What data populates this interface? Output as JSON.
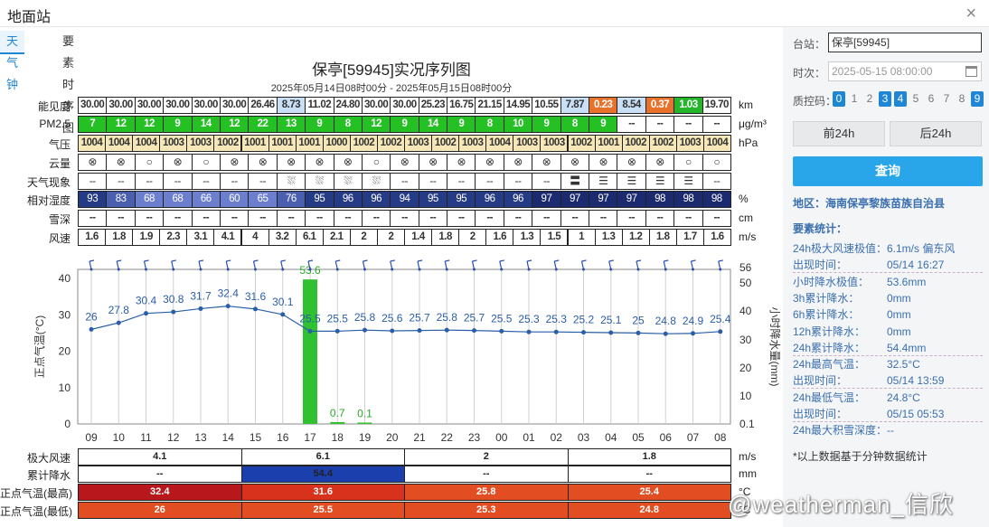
{
  "window": {
    "title": "地面站",
    "close_glyph": "×"
  },
  "tabs": [
    {
      "label": "天气钟",
      "active": true
    },
    {
      "label": "要素时序图",
      "active": false
    }
  ],
  "chart": {
    "title": "保亭[59945]实况序列图",
    "subtitle": "2025年05月14日08时00分 - 2025年05月15日08时00分"
  },
  "table": {
    "rows": [
      {
        "label": "能见度",
        "unit": "km",
        "key": "vis"
      },
      {
        "label": "PM2.5",
        "unit": "μg/m³",
        "key": "pm"
      },
      {
        "label": "气压",
        "unit": "hPa",
        "key": "pres"
      },
      {
        "label": "云量",
        "unit": "",
        "key": "cloud"
      },
      {
        "label": "天气现象",
        "unit": "",
        "key": "wx"
      },
      {
        "label": "相对湿度",
        "unit": "%",
        "key": "rh"
      },
      {
        "label": "雪深",
        "unit": "cm",
        "key": "snow"
      },
      {
        "label": "风速",
        "unit": "m/s",
        "key": "ws"
      }
    ],
    "vis": [
      "30.00",
      "30.00",
      "30.00",
      "30.00",
      "30.00",
      "30.00",
      "26.46",
      "8.73",
      "11.02",
      "24.80",
      "30.00",
      "30.00",
      "25.23",
      "16.75",
      "21.15",
      "14.95",
      "10.55",
      "7.87",
      "0.23",
      "8.54",
      "0.37",
      "1.03",
      "19.70"
    ],
    "vis_colors": [
      "#fff",
      "#fff",
      "#fff",
      "#fff",
      "#fff",
      "#fff",
      "#fff",
      "#c8dff5",
      "#fff",
      "#fff",
      "#fff",
      "#fff",
      "#fff",
      "#fff",
      "#fff",
      "#fff",
      "#fff",
      "#c8dff5",
      "#e8722a",
      "#c8dff5",
      "#e8722a",
      "#24b52b",
      "#fff"
    ],
    "pm": [
      "7",
      "12",
      "12",
      "9",
      "14",
      "12",
      "22",
      "13",
      "9",
      "8",
      "12",
      "9",
      "14",
      "9",
      "8",
      "10",
      "9",
      "8",
      "9",
      "--",
      "--",
      "--",
      "--"
    ],
    "pres": [
      "1004",
      "1004",
      "1004",
      "1003",
      "1003",
      "1002",
      "1001",
      "1001",
      "1001",
      "1000",
      "1002",
      "1002",
      "1003",
      "1002",
      "1003",
      "1004",
      "1003",
      "1003",
      "1002",
      "1001",
      "1002",
      "1002",
      "1003",
      "1004"
    ],
    "cloud": [
      "⊗",
      "⊗",
      "○",
      "⊗",
      "○",
      "⊗",
      "⊗",
      "⊗",
      "⊗",
      "⊗",
      "○",
      "⊗",
      "⊗",
      "⊗",
      "⊗",
      "⊗",
      "⊗",
      "⊗",
      "⊗",
      "⊗",
      "⊗",
      "○",
      "○"
    ],
    "wx": [
      "--",
      "--",
      "--",
      "--",
      "--",
      "--",
      "--",
      "⛆",
      "⛆",
      "⛆",
      "⛆",
      "--",
      "--",
      "--",
      "--",
      "--",
      "--",
      "〓",
      "☰",
      "☰",
      "☰",
      "☰",
      "--"
    ],
    "rh": [
      "93",
      "83",
      "68",
      "68",
      "66",
      "60",
      "65",
      "76",
      "95",
      "96",
      "96",
      "94",
      "95",
      "95",
      "96",
      "96",
      "97",
      "97",
      "97",
      "97",
      "98",
      "98",
      "98"
    ],
    "snow": [
      "--",
      "--",
      "--",
      "--",
      "--",
      "--",
      "--",
      "--",
      "--",
      "--",
      "--",
      "--",
      "--",
      "--",
      "--",
      "--",
      "--",
      "--",
      "--",
      "--",
      "--",
      "--",
      "--"
    ],
    "ws": [
      "1.6",
      "1.8",
      "1.9",
      "2.3",
      "3.1",
      "4.1",
      "4",
      "3.2",
      "6.1",
      "2.1",
      "2",
      "2",
      "1.4",
      "1.8",
      "2",
      "1.6",
      "1.3",
      "1.5",
      "1",
      "1.3",
      "1.2",
      "1.8",
      "1.7",
      "1.6"
    ]
  },
  "chart_data": {
    "type": "line",
    "x": [
      "09",
      "10",
      "11",
      "12",
      "13",
      "14",
      "15",
      "16",
      "17",
      "18",
      "19",
      "20",
      "21",
      "22",
      "23",
      "00",
      "01",
      "02",
      "03",
      "04",
      "05",
      "06",
      "07",
      "08"
    ],
    "series": [
      {
        "name": "",
        "values": [
          26,
          27.8,
          30.4,
          30.8,
          31.7,
          32.4,
          31.6,
          30.1,
          25.5,
          25.5,
          25.8,
          25.6,
          25.7,
          25.8,
          25.7,
          25.5,
          25.3,
          25.3,
          25.2,
          25.1,
          25,
          24.8,
          24.9,
          25.4
        ],
        "color": "#2a5ea8"
      },
      {
        "name": "",
        "type": "bar",
        "values": [
          0,
          0,
          0,
          0,
          0,
          0,
          0,
          0,
          53.6,
          0.7,
          0.1,
          0,
          0,
          0,
          0,
          0,
          0,
          0,
          0,
          0,
          0,
          0,
          0,
          0
        ],
        "color": "#2fc12f"
      }
    ],
    "ylabel": "正点气温(°C)",
    "y2label": "小时降水量(mm)",
    "ylim": [
      0,
      42
    ],
    "yticks": [
      0,
      10,
      20,
      30,
      40
    ],
    "y2ticks": [
      "0.1",
      "10",
      "20",
      "30",
      "40",
      "50",
      "56"
    ],
    "grid": true
  },
  "bottom": {
    "rows": [
      {
        "label": "极大风速",
        "unit": "m/s",
        "cells": [
          "4.1",
          "6.1",
          "2",
          "1.8"
        ],
        "colors": [
          "#fff",
          "#fff",
          "#fff",
          "#fff"
        ],
        "text": [
          "#222",
          "#222",
          "#222",
          "#222"
        ]
      },
      {
        "label": "累计降水",
        "unit": "mm",
        "cells": [
          "--",
          "54.4",
          "--",
          "--"
        ],
        "colors": [
          "#fff",
          "#1c3fae",
          "#fff",
          "#fff"
        ],
        "text": [
          "#222",
          "#222",
          "#222",
          "#222"
        ]
      },
      {
        "label": "正点气温(最高)",
        "unit": "°C",
        "cells": [
          "32.4",
          "31.6",
          "25.8",
          "25.4"
        ],
        "colors": [
          "#b8171c",
          "#d8311c",
          "#e24d22",
          "#e24d22"
        ],
        "text": [
          "#fff",
          "#fff",
          "#fff",
          "#fff"
        ]
      },
      {
        "label": "正点气温(最低)",
        "unit": "°C",
        "cells": [
          "26",
          "25.5",
          "25.3",
          "24.8"
        ],
        "colors": [
          "#e24d22",
          "#e24d22",
          "#e24d22",
          "#e24d22"
        ],
        "text": [
          "#fff",
          "#fff",
          "#fff",
          "#fff"
        ]
      }
    ]
  },
  "side": {
    "station_label": "台站：",
    "station_value": "保亭[59945]",
    "time_label": "时次：",
    "time_value": "2025-05-15 08:00:00",
    "qc_label": "质控码：",
    "qc": [
      "0",
      "1",
      "2",
      "3",
      "4",
      "5",
      "6",
      "7",
      "8",
      "9"
    ],
    "qc_on": [
      0,
      3,
      4,
      9
    ],
    "prev": "前24h",
    "next": "后24h",
    "query": "查询",
    "region": "地区：海南保亭黎族苗族自治县",
    "stats_title": "要素统计：",
    "stats": [
      {
        "k": "24h极大风速极值：",
        "v": "6.1m/s 偏东风",
        "dash": false
      },
      {
        "k": "出现时间：",
        "v": "05/14 16:27",
        "dash": true
      },
      {
        "k": "小时降水极值：",
        "v": "53.6mm",
        "dash": false
      },
      {
        "k": "3h累计降水：",
        "v": "0mm",
        "dash": false
      },
      {
        "k": "6h累计降水：",
        "v": "0mm",
        "dash": false
      },
      {
        "k": "12h累计降水：",
        "v": "0mm",
        "dash": false
      },
      {
        "k": "24h累计降水：",
        "v": "54.4mm",
        "dash": true
      },
      {
        "k": "24h最高气温：",
        "v": "32.5°C",
        "dash": false
      },
      {
        "k": "出现时间：",
        "v": "05/14 13:59",
        "dash": true
      },
      {
        "k": "24h最低气温：",
        "v": "24.8°C",
        "dash": false
      },
      {
        "k": "出现时间：",
        "v": "05/15 05:53",
        "dash": true
      },
      {
        "k": "24h最大积雪深度：",
        "v": "--",
        "dash": false
      }
    ],
    "note": "*以上数据基于分钟数据统计"
  },
  "watermark": "@weatherman_信欣"
}
